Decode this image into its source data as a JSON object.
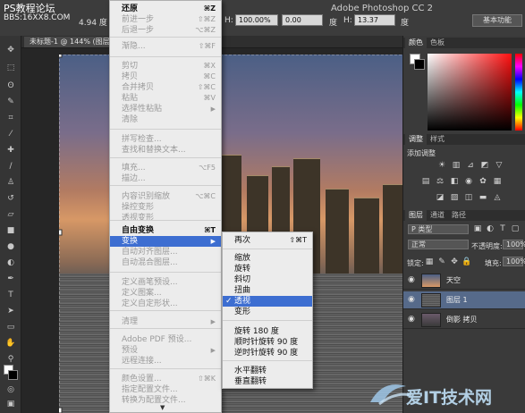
{
  "watermark": {
    "line1": "PS教程论坛",
    "line2": "BBS:16XX8.COM",
    "site_logo": "爱IT技术网"
  },
  "app": {
    "title": "Adobe Photoshop CC 2"
  },
  "options_bar": {
    "h_label": "H:",
    "h_value": "100.00%",
    "angle_value": "0.00",
    "angle_unit": "度",
    "h2_label": "H:",
    "h2_value": "13.37",
    "h2_unit": "度",
    "scale_partial": "4.94 度",
    "workspace": "基本功能"
  },
  "document": {
    "tab_label": "未标题-1 @ 144% (图层"
  },
  "edit_menu": {
    "items": [
      {
        "label": "还原",
        "shortcut": "⌘Z",
        "state": "bold"
      },
      {
        "label": "前进一步",
        "shortcut": "⇧⌘Z",
        "state": "dim"
      },
      {
        "label": "后退一步",
        "shortcut": "⌥⌘Z",
        "state": "dim"
      },
      {
        "label": "渐隐...",
        "shortcut": "⇧⌘F",
        "state": "dim"
      },
      {
        "label": "剪切",
        "shortcut": "⌘X",
        "state": "dim"
      },
      {
        "label": "拷贝",
        "shortcut": "⌘C",
        "state": "dim"
      },
      {
        "label": "合并拷贝",
        "shortcut": "⇧⌘C",
        "state": "dim"
      },
      {
        "label": "粘贴",
        "shortcut": "⌘V",
        "state": "dim"
      },
      {
        "label": "选择性粘贴",
        "shortcut": "",
        "state": "dim",
        "submenu": true
      },
      {
        "label": "清除",
        "shortcut": "",
        "state": "dim"
      },
      {
        "label": "拼写检查...",
        "shortcut": "",
        "state": "dim"
      },
      {
        "label": "查找和替换文本...",
        "shortcut": "",
        "state": "dim"
      },
      {
        "label": "填充...",
        "shortcut": "⌥F5",
        "state": "dim"
      },
      {
        "label": "描边...",
        "shortcut": "",
        "state": "dim"
      },
      {
        "label": "内容识别缩放",
        "shortcut": "⌥⌘C",
        "state": "dim"
      },
      {
        "label": "操控变形",
        "shortcut": "",
        "state": "dim"
      },
      {
        "label": "透视变形",
        "shortcut": "",
        "state": "dim"
      },
      {
        "label": "自由变换",
        "shortcut": "⌘T",
        "state": "bold"
      },
      {
        "label": "变换",
        "shortcut": "",
        "state": "highlight",
        "submenu": true
      },
      {
        "label": "自动对齐图层...",
        "shortcut": "",
        "state": "dim"
      },
      {
        "label": "自动混合图层...",
        "shortcut": "",
        "state": "dim"
      },
      {
        "label": "定义画笔预设...",
        "shortcut": "",
        "state": "dim"
      },
      {
        "label": "定义图案...",
        "shortcut": "",
        "state": "dim"
      },
      {
        "label": "定义自定形状...",
        "shortcut": "",
        "state": "dim"
      },
      {
        "label": "清理",
        "shortcut": "",
        "state": "dim",
        "submenu": true
      },
      {
        "label": "Adobe PDF 预设...",
        "shortcut": "",
        "state": "dim"
      },
      {
        "label": "预设",
        "shortcut": "",
        "state": "dim",
        "submenu": true
      },
      {
        "label": "远程连接...",
        "shortcut": "",
        "state": "dim"
      },
      {
        "label": "颜色设置...",
        "shortcut": "⇧⌘K",
        "state": "dim"
      },
      {
        "label": "指定配置文件...",
        "shortcut": "",
        "state": "dim"
      },
      {
        "label": "转换为配置文件...",
        "shortcut": "",
        "state": "dim"
      }
    ],
    "more_arrow": "▼"
  },
  "transform_submenu": {
    "items": [
      {
        "label": "再次",
        "shortcut": "⇧⌘T"
      },
      {
        "label": "缩放",
        "shortcut": ""
      },
      {
        "label": "旋转",
        "shortcut": ""
      },
      {
        "label": "斜切",
        "shortcut": ""
      },
      {
        "label": "扭曲",
        "shortcut": ""
      },
      {
        "label": "透视",
        "shortcut": "",
        "checked": true
      },
      {
        "label": "变形",
        "shortcut": ""
      },
      {
        "label": "旋转 180 度",
        "shortcut": ""
      },
      {
        "label": "顺时针旋转 90 度",
        "shortcut": ""
      },
      {
        "label": "逆时针旋转 90 度",
        "shortcut": ""
      },
      {
        "label": "水平翻转",
        "shortcut": ""
      },
      {
        "label": "垂直翻转",
        "shortcut": ""
      }
    ],
    "checkmark": "✓"
  },
  "panels": {
    "color_tabs": [
      "颜色",
      "色板"
    ],
    "adjust_tabs": [
      "调整",
      "样式"
    ],
    "adjust_title": "添加调整",
    "layers_tabs": [
      "图层",
      "通道",
      "路径"
    ],
    "kind_label": "P 类型",
    "blend_mode": "正常",
    "opacity_label": "不透明度:",
    "opacity_value": "100%",
    "lock_label": "锁定:",
    "fill_label": "填充:",
    "fill_value": "100%",
    "layers": [
      {
        "name": "天空",
        "active": false
      },
      {
        "name": "图层 1",
        "active": true
      },
      {
        "name": "倒影 拷贝",
        "active": false
      }
    ]
  },
  "colors": {
    "menu_highlight": "#3d6ed1",
    "active_layer": "#566a8a",
    "panel_bg": "#3a3a3a"
  }
}
